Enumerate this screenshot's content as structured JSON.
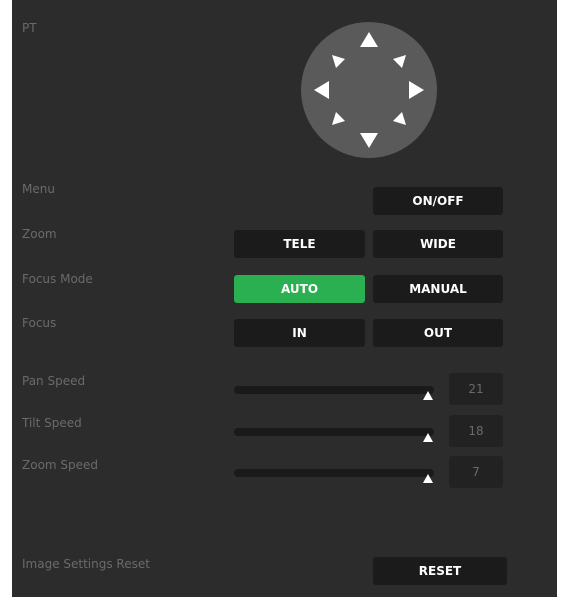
{
  "labels": {
    "pt": "PT",
    "menu": "Menu",
    "zoom": "Zoom",
    "focus_mode": "Focus Mode",
    "focus": "Focus",
    "pan_speed": "Pan Speed",
    "tilt_speed": "Tilt Speed",
    "zoom_speed": "Zoom Speed",
    "image_settings_reset": "Image Settings Reset"
  },
  "buttons": {
    "menu_onoff": "ON/OFF",
    "zoom_tele": "TELE",
    "zoom_wide": "WIDE",
    "focus_auto": "AUTO",
    "focus_manual": "MANUAL",
    "focus_in": "IN",
    "focus_out": "OUT",
    "reset": "RESET"
  },
  "focus_mode_selected": "AUTO",
  "speeds": {
    "pan": {
      "value": "21",
      "fraction": 0.97
    },
    "tilt": {
      "value": "18",
      "fraction": 0.97
    },
    "zoom": {
      "value": "7",
      "fraction": 0.97
    }
  },
  "colors": {
    "panel_bg": "#2c2c2c",
    "button_bg": "#1b1b1b",
    "active_green": "#2aaf51",
    "label_text": "#6a6a6a",
    "joystick_bg": "#5a5a5a"
  },
  "icons": {
    "up": "arrow-up-icon",
    "down": "arrow-down-icon",
    "left": "arrow-left-icon",
    "right": "arrow-right-icon",
    "up_left": "arrow-up-left-icon",
    "up_right": "arrow-up-right-icon",
    "down_left": "arrow-down-left-icon",
    "down_right": "arrow-down-right-icon"
  }
}
